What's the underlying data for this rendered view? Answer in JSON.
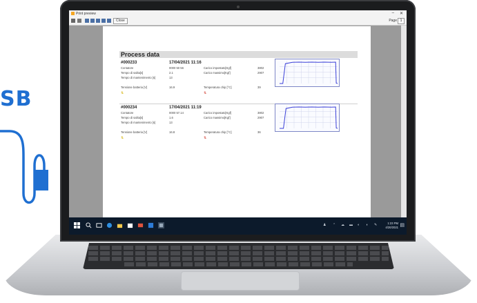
{
  "marketing": {
    "usb_text": "SB"
  },
  "window": {
    "title": "Print preview",
    "controls": {
      "minimize": "–",
      "close": "✕"
    },
    "toolbar": {
      "close_label": "Close",
      "page_label": "Page",
      "page_value": "1"
    }
  },
  "report": {
    "heading": "Process data",
    "records": [
      {
        "id": "#000233",
        "datetime": "17/04/2021 11:16",
        "rows": [
          {
            "label": "Contatore",
            "value": "0000 50 56",
            "label2": "Carico impostato[Kgf]",
            "value2": "3802"
          },
          {
            "label": "Tempo di salita[s]",
            "value": "2.1",
            "label2": "Carico massimo[Kgf]",
            "value2": "2907"
          },
          {
            "label": "Tempo di mantenimento [s]",
            "value": "13",
            "label2": "",
            "value2": ""
          },
          {
            "label": "Tensione batteria [V]",
            "value": "16.9",
            "label2": "Temperatura chip [°C]",
            "value2": "39"
          }
        ],
        "chart": {
          "type": "line",
          "x": [
            0,
            5,
            9,
            20,
            30,
            40,
            50,
            60,
            70,
            80,
            87,
            88,
            90
          ],
          "values": [
            0,
            0,
            90,
            96,
            97,
            96,
            97,
            96,
            97,
            96,
            97,
            2,
            0
          ],
          "ylim": [
            0,
            100
          ]
        }
      },
      {
        "id": "#000234",
        "datetime": "17/04/2021 11:19",
        "rows": [
          {
            "label": "Contatore",
            "value": "0000 57.14",
            "label2": "Carico impostato[Kgf]",
            "value2": "3802"
          },
          {
            "label": "Tempo di salita[s]",
            "value": "1.6",
            "label2": "Carico massimo[Kgf]",
            "value2": "2907"
          },
          {
            "label": "Tempo di mantenimento [s]",
            "value": "13",
            "label2": "",
            "value2": ""
          },
          {
            "label": "Tensione batteria [V]",
            "value": "16.8",
            "label2": "Temperatura chip [°C]",
            "value2": "36"
          }
        ],
        "chart": {
          "type": "line",
          "x": [
            0,
            6,
            10,
            20,
            30,
            40,
            50,
            60,
            70,
            80,
            87,
            88,
            90
          ],
          "values": [
            0,
            0,
            90,
            96,
            97,
            96,
            97,
            96,
            97,
            96,
            97,
            2,
            0
          ],
          "ylim": [
            0,
            100
          ]
        }
      }
    ]
  },
  "taskbar": {
    "clock_time": "1:23 PM",
    "clock_date": "4/20/2021"
  },
  "colors": {
    "usb_blue": "#1f6fd1",
    "chart_line": "#3a3fd8",
    "chart_grid": "#c8cde8",
    "taskbar": "#0c1a2b"
  }
}
